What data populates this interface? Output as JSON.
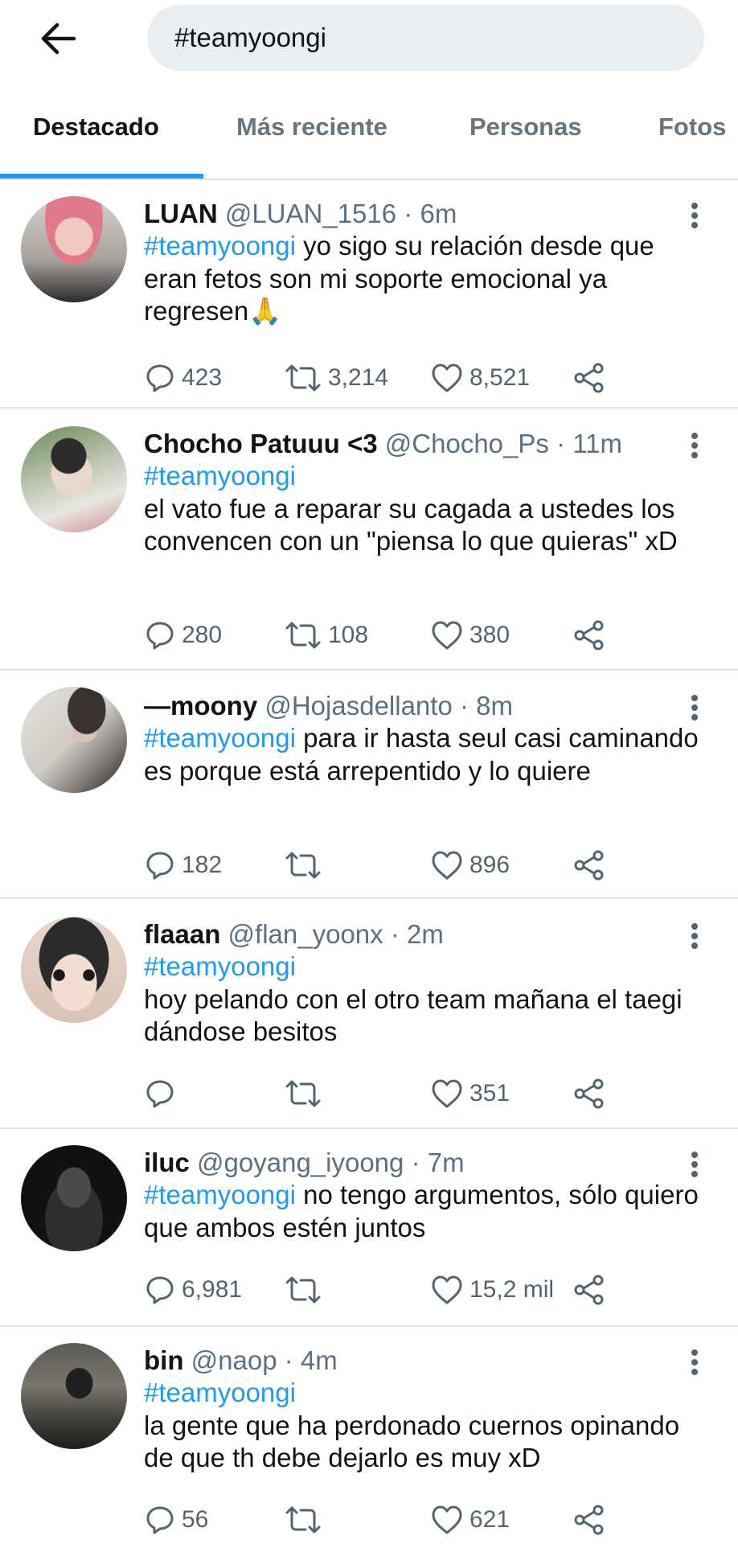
{
  "search": {
    "query": "#teamyoongi"
  },
  "tabs": [
    {
      "label": "Destacado",
      "active": true
    },
    {
      "label": "Más reciente",
      "active": false
    },
    {
      "label": "Personas",
      "active": false
    },
    {
      "label": "Fotos",
      "active": false
    }
  ],
  "colors": {
    "accent": "#1d9bf0",
    "text": "#0f1419",
    "secondary": "#5b7083",
    "divider": "#dfe5ea"
  },
  "tweets": [
    {
      "name": "LUAN",
      "handle": "@LUAN_1516",
      "time": "6m",
      "hashtag": "#teamyoongi",
      "text": " yo sigo su relación desde que eran fetos son mi soporte emocional ya regresen🙏",
      "replies": "423",
      "retweets": "3,214",
      "likes": "8,521"
    },
    {
      "name": "Chocho Patuuu <3",
      "handle": "@Chocho_Ps",
      "time": "11m",
      "hashtag": "#teamyoongi",
      "text": "el vato fue a reparar su cagada a ustedes los convencen con un \"piensa lo que quieras\" xD",
      "replies": "280",
      "retweets": "108",
      "likes": "380"
    },
    {
      "name": "—moony",
      "handle": "@Hojasdellanto",
      "time": "8m",
      "hashtag": "#teamyoongi",
      "text": " para ir hasta seul casi caminando es porque está arrepentido y lo quiere",
      "replies": "182",
      "retweets": "",
      "likes": "896"
    },
    {
      "name": "flaaan",
      "handle": "@flan_yoonx",
      "time": "2m",
      "hashtag": "#teamyoongi",
      "text": "hoy pelando con el otro team mañana el taegi dándose besitos",
      "replies": "",
      "retweets": "",
      "likes": "351"
    },
    {
      "name": "iluc",
      "handle": "@goyang_iyoong",
      "time": "7m",
      "hashtag": "#teamyoongi",
      "text": " no tengo argumentos, sólo quiero que ambos estén juntos",
      "replies": "6,981",
      "retweets": "",
      "likes": "15,2 mil"
    },
    {
      "name": "bin",
      "handle": "@naop",
      "time": "4m",
      "hashtag": "#teamyoongi",
      "text": "la gente que ha perdonado cuernos opinando de que th debe dejarlo es muy xD",
      "replies": "56",
      "retweets": "",
      "likes": "621"
    }
  ]
}
